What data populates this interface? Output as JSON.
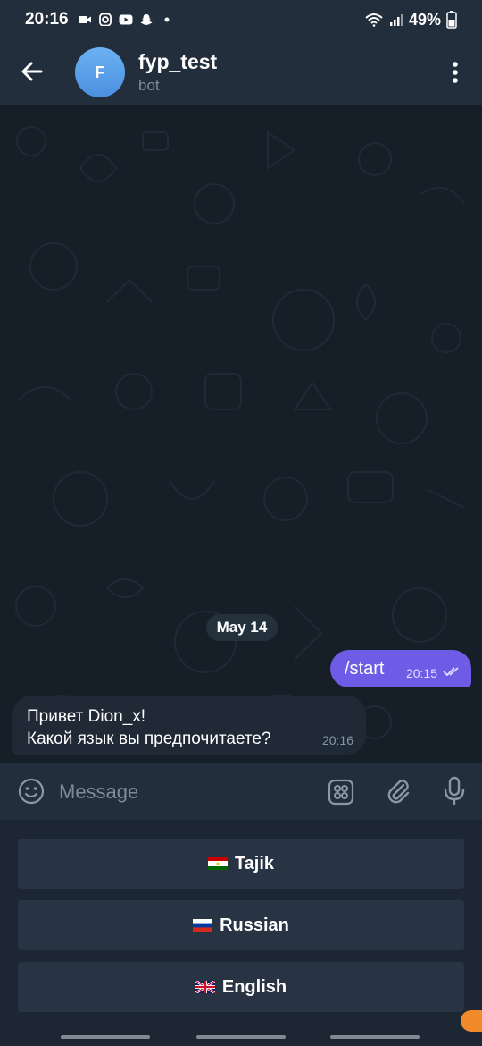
{
  "status_bar": {
    "time": "20:16",
    "battery": "49%"
  },
  "header": {
    "avatar_letter": "F",
    "title": "fyp_test",
    "subtitle": "bot"
  },
  "chat": {
    "date": "May 14",
    "outgoing": {
      "text": "/start",
      "time": "20:15"
    },
    "incoming": {
      "line1": "Привет Dion_x!",
      "line2": "Какой язык вы предпочитаете?",
      "time": "20:16"
    }
  },
  "composer": {
    "placeholder": "Message"
  },
  "keyboard": {
    "buttons": [
      {
        "label": "Tajik",
        "flag": "tajikistan-flag-icon"
      },
      {
        "label": "Russian",
        "flag": "russia-flag-icon"
      },
      {
        "label": "English",
        "flag": "uk-flag-icon"
      }
    ]
  },
  "colors": {
    "accent": "#6e5ce6",
    "header_bg": "#222e3b",
    "chat_bg": "#161e27",
    "bubble_in": "#1f2a36",
    "button_bg": "#283443"
  }
}
